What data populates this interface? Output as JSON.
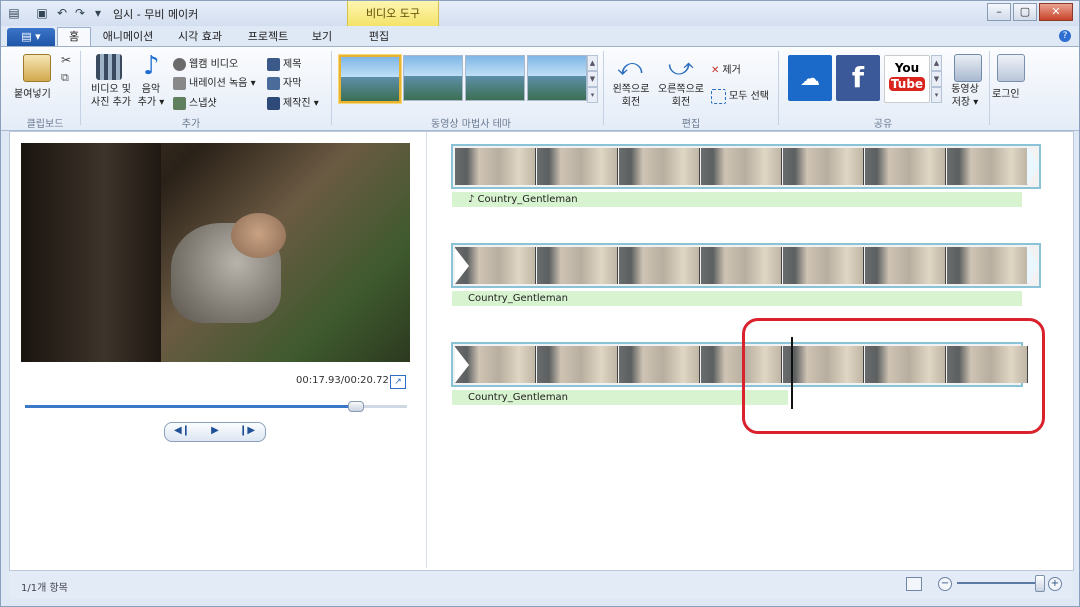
{
  "window": {
    "title": "임시 - 무비 메이커",
    "context_tab": "비디오 도구"
  },
  "tabs": [
    "홈",
    "애니메이션",
    "시각 효과",
    "프로젝트",
    "보기",
    "편집"
  ],
  "ribbon": {
    "paste": "붙여넣기",
    "clipboard_group": "클립보드",
    "add_videos": [
      "비디오 및",
      "사진 추가"
    ],
    "add_music": [
      "음악",
      "추가"
    ],
    "webcam": "웹캠 비디오",
    "narration": "내레이션 녹음",
    "snapshot": "스냅샷",
    "title": "제목",
    "caption": "자막",
    "credits": "제작진",
    "add_group": "추가",
    "themes_group": "동영상 마법사 테마",
    "rotate_left": [
      "왼쪽으로",
      "회전"
    ],
    "rotate_right": [
      "오른쪽으로",
      "회전"
    ],
    "remove": "제거",
    "select_all": "모두 선택",
    "editing_group": "편집",
    "share_group": "공유",
    "save_movie": [
      "동영상",
      "저장"
    ],
    "sign_in": "로그인",
    "share_services": [
      "OneDrive",
      "Facebook",
      "YouTube"
    ]
  },
  "preview": {
    "time": "00:17.93/00:20.72",
    "progress": 0.865
  },
  "storyboard": {
    "tracks": [
      {
        "caption": "♪ Country_Gentleman"
      },
      {
        "caption": "Country_Gentleman"
      },
      {
        "caption": "Country_Gentleman"
      }
    ]
  },
  "status": {
    "item_count": "1/1개 항목"
  },
  "colors": {
    "accent": "#3c78c8",
    "highlight": "#d9222c",
    "caption_bg": "#d8f3cf"
  }
}
